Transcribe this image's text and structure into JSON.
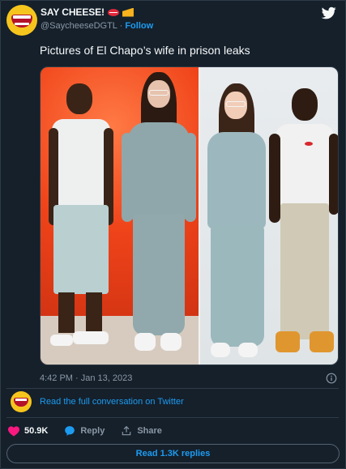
{
  "author": {
    "name": "SAY CHEESE!",
    "handle": "@SaycheeseDGTL",
    "separator": "·",
    "follow_label": "Follow",
    "name_emojis": [
      "lips-icon",
      "cheese-icon"
    ],
    "avatar_icon": "grinning-mouth-icon"
  },
  "tweet": {
    "text": "Pictures of El Chapo’s wife in prison leaks",
    "timestamp": "4:42 PM · Jan 13, 2023"
  },
  "conversation": {
    "link_label": "Read the full conversation on Twitter"
  },
  "actions": {
    "like_count": "50.9K",
    "reply_label": "Reply",
    "share_label": "Share"
  },
  "read_replies_label": "Read 1.3K replies",
  "colors": {
    "background": "#15202b",
    "accent": "#1d9bf0",
    "like": "#f91880",
    "muted": "#8b98a5",
    "border": "#2f3b47"
  }
}
